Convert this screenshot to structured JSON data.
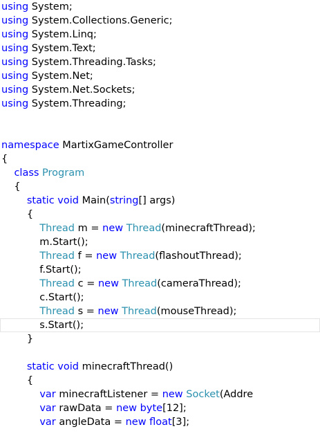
{
  "editor": {
    "current_line_index": 23,
    "colors": {
      "keyword": "#0000ff",
      "type": "#2b91af",
      "text": "#000000",
      "current_line_border": "#e4e4e4"
    },
    "lines": [
      [
        {
          "t": "kw",
          "v": "using"
        },
        {
          "t": "tx",
          "v": " System;"
        }
      ],
      [
        {
          "t": "kw",
          "v": "using"
        },
        {
          "t": "tx",
          "v": " System.Collections.Generic;"
        }
      ],
      [
        {
          "t": "kw",
          "v": "using"
        },
        {
          "t": "tx",
          "v": " System.Linq;"
        }
      ],
      [
        {
          "t": "kw",
          "v": "using"
        },
        {
          "t": "tx",
          "v": " System.Text;"
        }
      ],
      [
        {
          "t": "kw",
          "v": "using"
        },
        {
          "t": "tx",
          "v": " System.Threading.Tasks;"
        }
      ],
      [
        {
          "t": "kw",
          "v": "using"
        },
        {
          "t": "tx",
          "v": " System.Net;"
        }
      ],
      [
        {
          "t": "kw",
          "v": "using"
        },
        {
          "t": "tx",
          "v": " System.Net.Sockets;"
        }
      ],
      [
        {
          "t": "kw",
          "v": "using"
        },
        {
          "t": "tx",
          "v": " System.Threading;"
        }
      ],
      [],
      [],
      [
        {
          "t": "kw",
          "v": "namespace"
        },
        {
          "t": "tx",
          "v": " MartixGameController"
        }
      ],
      [
        {
          "t": "tx",
          "v": "{"
        }
      ],
      [
        {
          "t": "tx",
          "v": "    "
        },
        {
          "t": "kw",
          "v": "class"
        },
        {
          "t": "tx",
          "v": " "
        },
        {
          "t": "ty",
          "v": "Program"
        }
      ],
      [
        {
          "t": "tx",
          "v": "    {"
        }
      ],
      [
        {
          "t": "tx",
          "v": "        "
        },
        {
          "t": "kw",
          "v": "static"
        },
        {
          "t": "tx",
          "v": " "
        },
        {
          "t": "kw",
          "v": "void"
        },
        {
          "t": "tx",
          "v": " Main("
        },
        {
          "t": "kw",
          "v": "string"
        },
        {
          "t": "tx",
          "v": "[] args)"
        }
      ],
      [
        {
          "t": "tx",
          "v": "        {"
        }
      ],
      [
        {
          "t": "tx",
          "v": "            "
        },
        {
          "t": "ty",
          "v": "Thread"
        },
        {
          "t": "tx",
          "v": " m = "
        },
        {
          "t": "kw",
          "v": "new"
        },
        {
          "t": "tx",
          "v": " "
        },
        {
          "t": "ty",
          "v": "Thread"
        },
        {
          "t": "tx",
          "v": "(minecraftThread);"
        }
      ],
      [
        {
          "t": "tx",
          "v": "            m.Start();"
        }
      ],
      [
        {
          "t": "tx",
          "v": "            "
        },
        {
          "t": "ty",
          "v": "Thread"
        },
        {
          "t": "tx",
          "v": " f = "
        },
        {
          "t": "kw",
          "v": "new"
        },
        {
          "t": "tx",
          "v": " "
        },
        {
          "t": "ty",
          "v": "Thread"
        },
        {
          "t": "tx",
          "v": "(flashoutThread);"
        }
      ],
      [
        {
          "t": "tx",
          "v": "            f.Start();"
        }
      ],
      [
        {
          "t": "tx",
          "v": "            "
        },
        {
          "t": "ty",
          "v": "Thread"
        },
        {
          "t": "tx",
          "v": " c = "
        },
        {
          "t": "kw",
          "v": "new"
        },
        {
          "t": "tx",
          "v": " "
        },
        {
          "t": "ty",
          "v": "Thread"
        },
        {
          "t": "tx",
          "v": "(cameraThread);"
        }
      ],
      [
        {
          "t": "tx",
          "v": "            c.Start();"
        }
      ],
      [
        {
          "t": "tx",
          "v": "            "
        },
        {
          "t": "ty",
          "v": "Thread"
        },
        {
          "t": "tx",
          "v": " s = "
        },
        {
          "t": "kw",
          "v": "new"
        },
        {
          "t": "tx",
          "v": " "
        },
        {
          "t": "ty",
          "v": "Thread"
        },
        {
          "t": "tx",
          "v": "(mouseThread);"
        }
      ],
      [
        {
          "t": "tx",
          "v": "            s.Start();"
        }
      ],
      [
        {
          "t": "tx",
          "v": "        }"
        }
      ],
      [],
      [
        {
          "t": "tx",
          "v": "        "
        },
        {
          "t": "kw",
          "v": "static"
        },
        {
          "t": "tx",
          "v": " "
        },
        {
          "t": "kw",
          "v": "void"
        },
        {
          "t": "tx",
          "v": " minecraftThread()"
        }
      ],
      [
        {
          "t": "tx",
          "v": "        {"
        }
      ],
      [
        {
          "t": "tx",
          "v": "            "
        },
        {
          "t": "kw",
          "v": "var"
        },
        {
          "t": "tx",
          "v": " minecraftListener = "
        },
        {
          "t": "kw",
          "v": "new"
        },
        {
          "t": "tx",
          "v": " "
        },
        {
          "t": "ty",
          "v": "Socket"
        },
        {
          "t": "tx",
          "v": "(Addre"
        }
      ],
      [
        {
          "t": "tx",
          "v": "            "
        },
        {
          "t": "kw",
          "v": "var"
        },
        {
          "t": "tx",
          "v": " rawData = "
        },
        {
          "t": "kw",
          "v": "new"
        },
        {
          "t": "tx",
          "v": " "
        },
        {
          "t": "kw",
          "v": "byte"
        },
        {
          "t": "tx",
          "v": "[12];"
        }
      ],
      [
        {
          "t": "tx",
          "v": "            "
        },
        {
          "t": "kw",
          "v": "var"
        },
        {
          "t": "tx",
          "v": " angleData = "
        },
        {
          "t": "kw",
          "v": "new"
        },
        {
          "t": "tx",
          "v": " "
        },
        {
          "t": "kw",
          "v": "float"
        },
        {
          "t": "tx",
          "v": "[3];"
        }
      ]
    ]
  }
}
